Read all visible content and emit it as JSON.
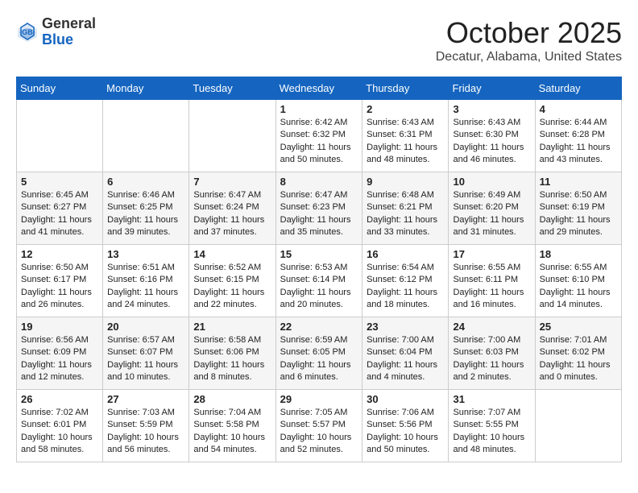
{
  "header": {
    "logo_general": "General",
    "logo_blue": "Blue",
    "month": "October 2025",
    "location": "Decatur, Alabama, United States"
  },
  "days_of_week": [
    "Sunday",
    "Monday",
    "Tuesday",
    "Wednesday",
    "Thursday",
    "Friday",
    "Saturday"
  ],
  "weeks": [
    [
      {
        "day": "",
        "content": ""
      },
      {
        "day": "",
        "content": ""
      },
      {
        "day": "",
        "content": ""
      },
      {
        "day": "1",
        "content": "Sunrise: 6:42 AM\nSunset: 6:32 PM\nDaylight: 11 hours\nand 50 minutes."
      },
      {
        "day": "2",
        "content": "Sunrise: 6:43 AM\nSunset: 6:31 PM\nDaylight: 11 hours\nand 48 minutes."
      },
      {
        "day": "3",
        "content": "Sunrise: 6:43 AM\nSunset: 6:30 PM\nDaylight: 11 hours\nand 46 minutes."
      },
      {
        "day": "4",
        "content": "Sunrise: 6:44 AM\nSunset: 6:28 PM\nDaylight: 11 hours\nand 43 minutes."
      }
    ],
    [
      {
        "day": "5",
        "content": "Sunrise: 6:45 AM\nSunset: 6:27 PM\nDaylight: 11 hours\nand 41 minutes."
      },
      {
        "day": "6",
        "content": "Sunrise: 6:46 AM\nSunset: 6:25 PM\nDaylight: 11 hours\nand 39 minutes."
      },
      {
        "day": "7",
        "content": "Sunrise: 6:47 AM\nSunset: 6:24 PM\nDaylight: 11 hours\nand 37 minutes."
      },
      {
        "day": "8",
        "content": "Sunrise: 6:47 AM\nSunset: 6:23 PM\nDaylight: 11 hours\nand 35 minutes."
      },
      {
        "day": "9",
        "content": "Sunrise: 6:48 AM\nSunset: 6:21 PM\nDaylight: 11 hours\nand 33 minutes."
      },
      {
        "day": "10",
        "content": "Sunrise: 6:49 AM\nSunset: 6:20 PM\nDaylight: 11 hours\nand 31 minutes."
      },
      {
        "day": "11",
        "content": "Sunrise: 6:50 AM\nSunset: 6:19 PM\nDaylight: 11 hours\nand 29 minutes."
      }
    ],
    [
      {
        "day": "12",
        "content": "Sunrise: 6:50 AM\nSunset: 6:17 PM\nDaylight: 11 hours\nand 26 minutes."
      },
      {
        "day": "13",
        "content": "Sunrise: 6:51 AM\nSunset: 6:16 PM\nDaylight: 11 hours\nand 24 minutes."
      },
      {
        "day": "14",
        "content": "Sunrise: 6:52 AM\nSunset: 6:15 PM\nDaylight: 11 hours\nand 22 minutes."
      },
      {
        "day": "15",
        "content": "Sunrise: 6:53 AM\nSunset: 6:14 PM\nDaylight: 11 hours\nand 20 minutes."
      },
      {
        "day": "16",
        "content": "Sunrise: 6:54 AM\nSunset: 6:12 PM\nDaylight: 11 hours\nand 18 minutes."
      },
      {
        "day": "17",
        "content": "Sunrise: 6:55 AM\nSunset: 6:11 PM\nDaylight: 11 hours\nand 16 minutes."
      },
      {
        "day": "18",
        "content": "Sunrise: 6:55 AM\nSunset: 6:10 PM\nDaylight: 11 hours\nand 14 minutes."
      }
    ],
    [
      {
        "day": "19",
        "content": "Sunrise: 6:56 AM\nSunset: 6:09 PM\nDaylight: 11 hours\nand 12 minutes."
      },
      {
        "day": "20",
        "content": "Sunrise: 6:57 AM\nSunset: 6:07 PM\nDaylight: 11 hours\nand 10 minutes."
      },
      {
        "day": "21",
        "content": "Sunrise: 6:58 AM\nSunset: 6:06 PM\nDaylight: 11 hours\nand 8 minutes."
      },
      {
        "day": "22",
        "content": "Sunrise: 6:59 AM\nSunset: 6:05 PM\nDaylight: 11 hours\nand 6 minutes."
      },
      {
        "day": "23",
        "content": "Sunrise: 7:00 AM\nSunset: 6:04 PM\nDaylight: 11 hours\nand 4 minutes."
      },
      {
        "day": "24",
        "content": "Sunrise: 7:00 AM\nSunset: 6:03 PM\nDaylight: 11 hours\nand 2 minutes."
      },
      {
        "day": "25",
        "content": "Sunrise: 7:01 AM\nSunset: 6:02 PM\nDaylight: 11 hours\nand 0 minutes."
      }
    ],
    [
      {
        "day": "26",
        "content": "Sunrise: 7:02 AM\nSunset: 6:01 PM\nDaylight: 10 hours\nand 58 minutes."
      },
      {
        "day": "27",
        "content": "Sunrise: 7:03 AM\nSunset: 5:59 PM\nDaylight: 10 hours\nand 56 minutes."
      },
      {
        "day": "28",
        "content": "Sunrise: 7:04 AM\nSunset: 5:58 PM\nDaylight: 10 hours\nand 54 minutes."
      },
      {
        "day": "29",
        "content": "Sunrise: 7:05 AM\nSunset: 5:57 PM\nDaylight: 10 hours\nand 52 minutes."
      },
      {
        "day": "30",
        "content": "Sunrise: 7:06 AM\nSunset: 5:56 PM\nDaylight: 10 hours\nand 50 minutes."
      },
      {
        "day": "31",
        "content": "Sunrise: 7:07 AM\nSunset: 5:55 PM\nDaylight: 10 hours\nand 48 minutes."
      },
      {
        "day": "",
        "content": ""
      }
    ]
  ]
}
